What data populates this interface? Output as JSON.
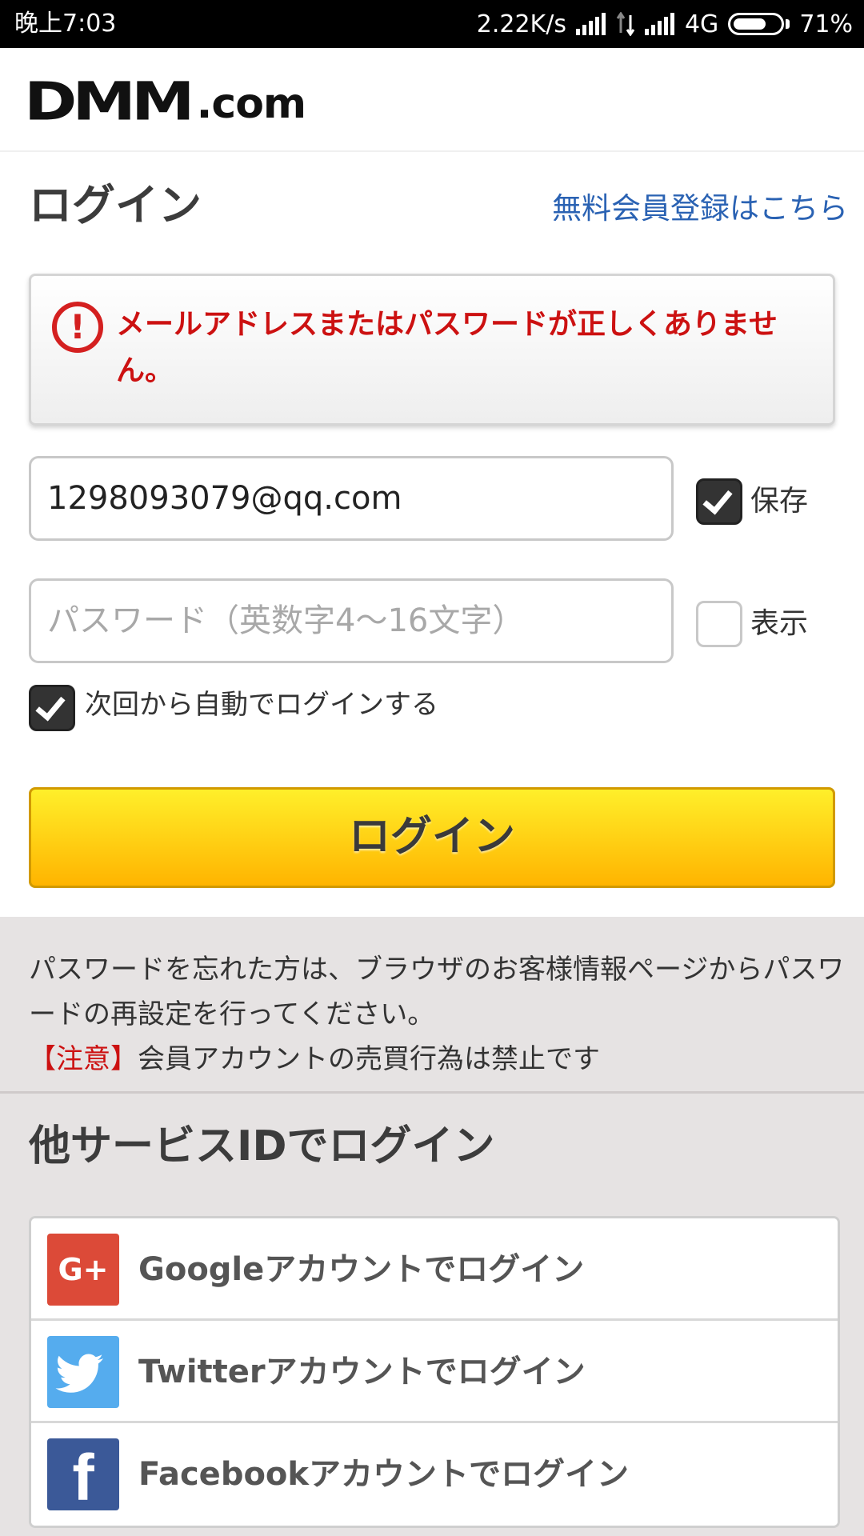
{
  "status_bar": {
    "time": "晚上7:03",
    "speed": "2.22K/s",
    "network": "4G",
    "battery": "71%",
    "battery_level": 0.71
  },
  "header": {
    "logo_main": "DMM",
    "logo_suffix": ".com"
  },
  "login": {
    "title": "ログイン",
    "register_link": "無料会員登録はこちら",
    "error_message": "メールアドレスまたはパスワードが正しくありません。",
    "email_value": "1298093079@qq.com",
    "password_placeholder": "パスワード（英数字4〜16文字）",
    "save_label": "保存",
    "save_checked": true,
    "show_label": "表示",
    "show_checked": false,
    "auto_login_label": "次回から自動でログインする",
    "auto_login_checked": true,
    "button_label": "ログイン"
  },
  "info": {
    "forgot_text": "パスワードを忘れた方は、ブラウザのお客様情報ページからパスワードの再設定を行ってください。",
    "notice_tag": "【注意】",
    "notice_text": "会員アカウントの売買行為は禁止です"
  },
  "other_login": {
    "title": "他サービスIDでログイン",
    "providers": [
      {
        "label": "Googleアカウントでログイン",
        "icon": "google-plus-icon",
        "icon_text": "G+",
        "color": "#dc4a38"
      },
      {
        "label": "Twitterアカウントでログイン",
        "icon": "twitter-bird-icon",
        "color": "#55acee"
      },
      {
        "label": "Facebookアカウントでログイン",
        "icon": "facebook-icon",
        "icon_text": "f",
        "color": "#3b5998"
      }
    ]
  }
}
